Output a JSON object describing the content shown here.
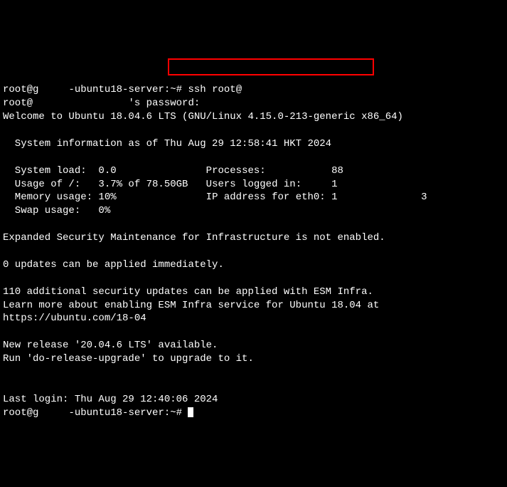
{
  "lines": {
    "prompt1_prefix": "root@g",
    "prompt1_hostname": "-ubuntu18-server:~#",
    "ssh_cmd": " ssh root@",
    "password_line_prefix": "root@",
    "password_line_suffix": "'s password:",
    "welcome": "Welcome to Ubuntu 18.04.6 LTS (GNU/Linux 4.15.0-213-generic x86_64)",
    "sysinfo_header": "  System information as of Thu Aug 29 12:58:41 HKT 2024",
    "sysload_label": "  System load:  ",
    "sysload_value": "0.0",
    "processes_label": "Processes:           ",
    "processes_value": "88",
    "usage_label": "  Usage of /:   ",
    "usage_value": "3.7% of 78.50GB",
    "users_label": "Users logged in:     ",
    "users_value": "1",
    "memory_label": "  Memory usage: ",
    "memory_value": "10%",
    "ip_label": "IP address for eth0: ",
    "ip_value": "1",
    "swap_label": "  Swap usage:   ",
    "swap_value": "0%",
    "esm_line": "Expanded Security Maintenance for Infrastructure is not enabled.",
    "updates_line": "0 updates can be applied immediately.",
    "security_line1": "110 additional security updates can be applied with ESM Infra.",
    "security_line2": "Learn more about enabling ESM Infra service for Ubuntu 18.04 at",
    "security_url": "https://ubuntu.com/18-04",
    "release_line1": "New release '20.04.6 LTS' available.",
    "release_line2": "Run 'do-release-upgrade' to upgrade to it.",
    "last_login": "Last login: Thu Aug 29 12:40:06 2024",
    "prompt2_prefix": "root@g",
    "prompt2_hostname": "-ubuntu18-server:~#"
  }
}
